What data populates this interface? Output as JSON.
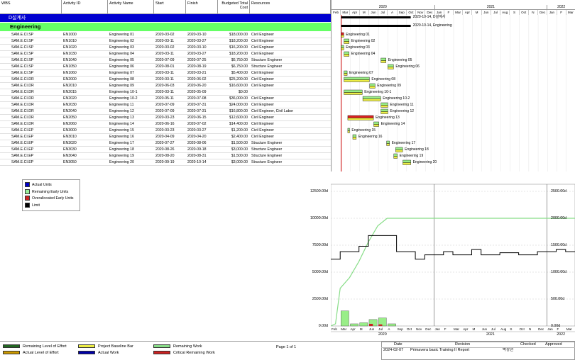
{
  "columns": {
    "wbs": "WBS",
    "activity_id": "Activity ID",
    "activity_name": "Activity Name",
    "start": "Start",
    "finish": "Finish",
    "budgeted_total_cost": "Budgeted Total Cost",
    "resources": "Resources"
  },
  "wbs_band": "D설계사",
  "group_band": "Engineering",
  "rows": [
    [
      "SAM.E.CI.SP",
      "EN1000",
      "Engineering 01",
      "2020-03-02",
      "2020-03-10",
      "$18,000.00",
      "Civil Engineer"
    ],
    [
      "SAM.E.CI.SP",
      "EN1010",
      "Engineering 02",
      "2020-03-11",
      "2020-03-27",
      "$18,200.00",
      "Civil Engineer"
    ],
    [
      "SAM.E.CI.SP",
      "EN1020",
      "Engineering 03",
      "2020-03-02",
      "2020-03-10",
      "$16,200.00",
      "Civil Engineer"
    ],
    [
      "SAM.E.CI.SP",
      "EN1030",
      "Engineering 04",
      "2020-03-11",
      "2020-03-27",
      "$18,200.00",
      "Civil Engineer"
    ],
    [
      "SAM.E.CI.SP",
      "EN1040",
      "Engineering 05",
      "2020-07-09",
      "2020-07-25",
      "$6,750.00",
      "Structure Engineer"
    ],
    [
      "SAM.E.CI.SP",
      "EN1050",
      "Engineering 06",
      "2020-08-01",
      "2020-08-19",
      "$6,750.00",
      "Structure Engineer"
    ],
    [
      "SAM.E.CI.SP",
      "EN1060",
      "Engineering 07",
      "2020-03-11",
      "2020-03-21",
      "$5,400.00",
      "Civil Engineer"
    ],
    [
      "SAM.E.CI.DR",
      "EN2000",
      "Engineering 08",
      "2020-03-11",
      "2020-06-02",
      "$25,200.00",
      "Civil Engineer"
    ],
    [
      "SAM.E.CI.DR",
      "EN2010",
      "Engineering 09",
      "2020-06-03",
      "2020-06-20",
      "$16,600.00",
      "Civil Engineer"
    ],
    [
      "SAM.E.CI.DR",
      "EN2015",
      "Engineering 10-1",
      "2020-03-11",
      "2020-05-09",
      "$0.00",
      ""
    ],
    [
      "SAM.E.CI.DR",
      "EN2020",
      "Engineering 10-2",
      "2020-05-11",
      "2020-07-08",
      "$36,000.00",
      "Civil Engineer"
    ],
    [
      "SAM.E.CI.DR",
      "EN2030",
      "Engineering 11",
      "2020-07-09",
      "2020-07-31",
      "$24,000.00",
      "Civil Engineer"
    ],
    [
      "SAM.E.CI.DR",
      "EN2040",
      "Engineering 12",
      "2020-07-09",
      "2020-07-31",
      "$16,800.00",
      "Civil Engineer, Civil Labor"
    ],
    [
      "SAM.E.CI.DR",
      "EN2050",
      "Engineering 13",
      "2020-03-23",
      "2020-06-15",
      "$12,600.00",
      "Civil Engineer"
    ],
    [
      "SAM.E.CI.DR",
      "EN2060",
      "Engineering 14",
      "2020-06-16",
      "2020-07-02",
      "$14,400.00",
      "Civil Engineer"
    ],
    [
      "SAM.E.CI.EP",
      "EN3000",
      "Engineering 15",
      "2020-03-23",
      "2020-03-27",
      "$1,200.00",
      "Civil Engineer"
    ],
    [
      "SAM.E.CI.EP",
      "EN3010",
      "Engineering 16",
      "2020-04-09",
      "2020-04-20",
      "$2,400.00",
      "Civil Engineer"
    ],
    [
      "SAM.E.CI.EP",
      "EN3020",
      "Engineering 17",
      "2020-07-27",
      "2020-08-06",
      "$1,500.00",
      "Structure Engineer"
    ],
    [
      "SAM.E.CI.EP",
      "EN3030",
      "Engineering 18",
      "2020-08-26",
      "2020-09-18",
      "$3,000.00",
      "Structure Engineer"
    ],
    [
      "SAM.E.CI.EP",
      "EN3040",
      "Engineering 19",
      "2020-08-20",
      "2020-08-31",
      "$1,500.00",
      "Structure Engineer"
    ],
    [
      "SAM.E.CI.EP",
      "EN3050",
      "Engineering 20",
      "2020-09-19",
      "2020-10-14",
      "$3,000.00",
      "Structure Engineer"
    ]
  ],
  "timescale": {
    "years": [
      "2020",
      "2021",
      "2022"
    ],
    "months": [
      "Feb",
      "Mar",
      "Apr",
      "M",
      "Jun",
      "Jul",
      "A",
      "Sep",
      "Oct",
      "Nov",
      "Dec",
      "Jan",
      "F",
      "Mar",
      "Apr",
      "M",
      "Jun",
      "Jul",
      "Aug",
      "S",
      "Oct",
      "N",
      "Dec",
      "Jan",
      "F",
      "Mar"
    ]
  },
  "gantt_summary_labels": [
    "2020-10-14, D설계사",
    "2020-10-14, Engineering"
  ],
  "gantt_bar_labels": [
    "Engineering 01",
    "Engineering 02",
    "Engineering 03",
    "Engineering 04",
    "Engineering 05",
    "Engineering 06",
    "Engineering 07",
    "Engineering 08",
    "Engineering 09",
    "Engineering 10-1",
    "Engineering 10-2",
    "Engineering 11",
    "Engineering 12",
    "Engineering 13",
    "Engineering 14",
    "Engineering 15",
    "Engineering 16",
    "Engineering 17",
    "Engineering 18",
    "Engineering 19",
    "Engineering 20"
  ],
  "legend": {
    "items": [
      {
        "label": "Actual Units",
        "color": "#0000cc"
      },
      {
        "label": "Remaining Early Units",
        "color": "#99ee99"
      },
      {
        "label": "Overallocated Early Units",
        "color": "#cc2222"
      },
      {
        "label": "Limit",
        "color": "#000000"
      }
    ]
  },
  "chart_data": {
    "type": "bar",
    "title": "",
    "left_axis_ticks": [
      "0.00d",
      "2500.00d",
      "5000.00d",
      "7500.00d",
      "10000.00d",
      "12500.00d"
    ],
    "right_axis_ticks": [
      "0.00d",
      "500.00d",
      "1000.00d",
      "1500.00d",
      "2000.00d",
      "2500.00d"
    ],
    "x_years": [
      "2020",
      "2021",
      "2022"
    ],
    "ylim_left": [
      0,
      12500
    ],
    "ylim_right": [
      0,
      2500
    ],
    "remaining_early_units_bars": [
      {
        "month": "2020-03",
        "value": 280
      },
      {
        "month": "2020-04",
        "value": 40
      },
      {
        "month": "2020-05",
        "value": 60
      },
      {
        "month": "2020-06",
        "value": 120
      },
      {
        "month": "2020-07",
        "value": 150
      },
      {
        "month": "2020-08",
        "value": 40
      }
    ],
    "overallocated_units_bars": [
      {
        "month": "2020-06",
        "value": 40
      },
      {
        "month": "2020-07",
        "value": 30
      }
    ],
    "cumulative_curve": [
      [
        0,
        0
      ],
      [
        0.5,
        200
      ],
      [
        1,
        3500
      ],
      [
        2,
        4500
      ],
      [
        3,
        6000
      ],
      [
        4,
        7800
      ],
      [
        5,
        9300
      ],
      [
        6,
        10000
      ],
      [
        26,
        10000
      ]
    ],
    "limit_line": [
      [
        0,
        6200
      ],
      [
        1,
        6200
      ],
      [
        1,
        6900
      ],
      [
        3,
        6900
      ],
      [
        3,
        7400
      ],
      [
        4,
        7400
      ],
      [
        4,
        8400
      ],
      [
        7,
        8400
      ],
      [
        7,
        6900
      ],
      [
        9,
        6900
      ],
      [
        9,
        6200
      ],
      [
        10,
        6200
      ],
      [
        10,
        6600
      ],
      [
        12,
        6600
      ],
      [
        12,
        6900
      ],
      [
        13,
        6900
      ],
      [
        13,
        6600
      ],
      [
        15,
        6600
      ],
      [
        15,
        7100
      ],
      [
        16,
        7100
      ],
      [
        16,
        6600
      ],
      [
        18,
        6600
      ],
      [
        18,
        6800
      ],
      [
        20,
        6800
      ],
      [
        20,
        6600
      ],
      [
        22,
        6600
      ],
      [
        22,
        6900
      ],
      [
        24,
        6900
      ],
      [
        24,
        7100
      ],
      [
        25,
        7100
      ],
      [
        25,
        6900
      ],
      [
        26,
        6900
      ]
    ]
  },
  "footer": {
    "legend_left": [
      {
        "label": "Remaining Level of Effort",
        "color": "#226622"
      },
      {
        "label": "Actual Level of Effort",
        "color": "#cc9900"
      },
      {
        "label": "Project Baseline Bar",
        "color": "#eeee44"
      },
      {
        "label": "Actual Work",
        "color": "#0000aa"
      },
      {
        "label": "Remaining Work",
        "color": "#88dd88"
      },
      {
        "label": "Critical Remaining Work",
        "color": "#cc2222"
      }
    ],
    "page": "Page 1 of 1",
    "date_hdr": "Date",
    "revision_hdr": "Revision",
    "checked_hdr": "Checked",
    "approved_hdr": "Approved",
    "date": "2024-02-07",
    "revision": "Primavera basic Training II Report",
    "checked": "박상현"
  }
}
